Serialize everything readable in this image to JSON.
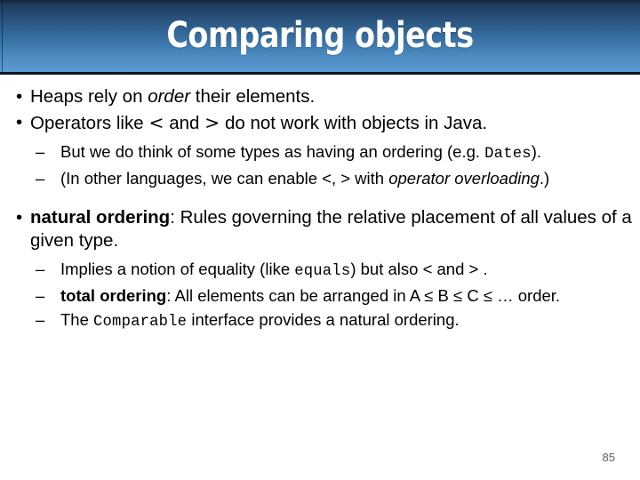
{
  "slide": {
    "title": "Comparing objects",
    "page_number": "85",
    "accent_color": "#3a74a8",
    "title_color": "#ffffff",
    "body_color": "#000000",
    "page_number_color": "#606060"
  },
  "bullets": {
    "b1": {
      "marker": "•",
      "part1": "Heaps rely on ",
      "em1": "order",
      "part2": " their elements."
    },
    "b2": {
      "marker": "•",
      "part1": "Operators like ",
      "op1": "<",
      "part2": " and ",
      "op2": ">",
      "part3": " do not work with objects in Java."
    },
    "s1": {
      "marker": "–",
      "part1": "But we do think of some types as having an ordering (e.g. ",
      "code1": "Dates",
      "part2": ")."
    },
    "s2": {
      "marker": "–",
      "part1": "(In other languages, we can enable <, > with ",
      "em1": "operator overloading",
      "part2": ".)"
    },
    "b3": {
      "marker": "•",
      "strong1": "natural ordering",
      "part1": ": Rules governing the relative placement of all values of a given type."
    },
    "s3": {
      "marker": "–",
      "part1": "Implies a notion of equality (like ",
      "code1": "equals",
      "part2": ") but also < and > ."
    },
    "s4": {
      "marker": "–",
      "strong1": "total ordering",
      "part1": ": All elements can be arranged in A ≤ B ≤ C ≤ … order."
    },
    "s5": {
      "marker": "–",
      "part1": "The ",
      "code1": "Comparable",
      "part2": " interface provides a natural ordering."
    }
  }
}
